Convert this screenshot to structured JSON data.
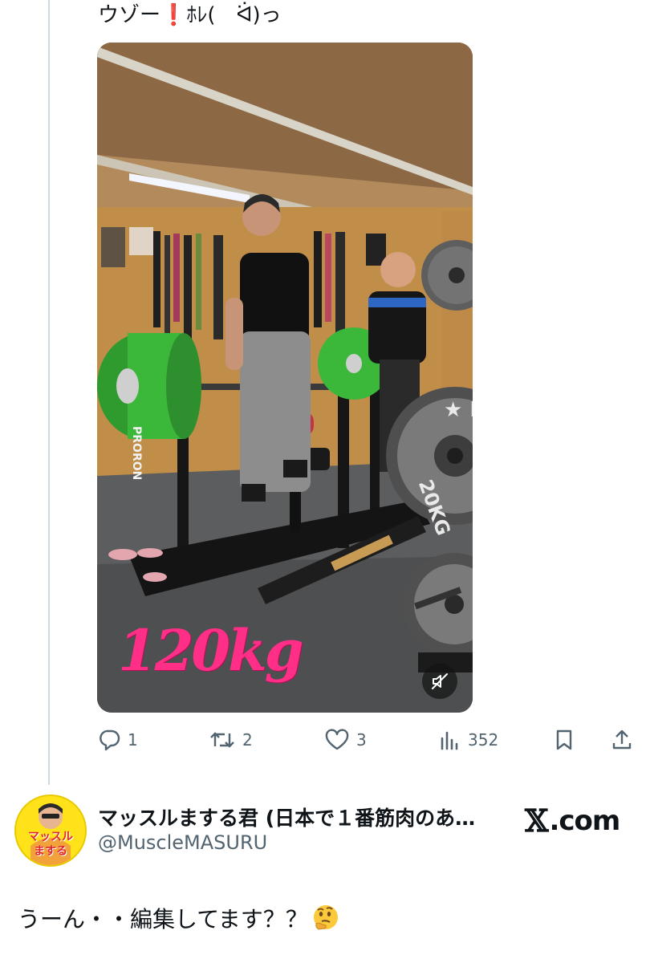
{
  "tweet": {
    "text_main": "ウゾー",
    "text_bang": "❗",
    "text_tail": "ﾎﾚ(　ᐛ)っ"
  },
  "video": {
    "overlay_text": "120kg",
    "muted": true
  },
  "actions": {
    "reply": {
      "icon": "reply-icon",
      "count": "1"
    },
    "repost": {
      "icon": "repost-icon",
      "count": "2"
    },
    "like": {
      "icon": "heart-icon",
      "count": "3"
    },
    "views": {
      "icon": "views-icon",
      "count": "352"
    },
    "bookmark": {
      "icon": "bookmark-icon"
    },
    "share": {
      "icon": "share-icon"
    }
  },
  "quote": {
    "author_name": "マッスルまする君 (日本で１番筋肉のあ…",
    "author_handle": "@MuscleMASURU",
    "source_glyph": "𝕏",
    "source_text": ".com",
    "avatar_text_top": "マッスル",
    "avatar_text_bottom": "まする"
  },
  "reply": {
    "text": "うーん・・編集してます？？",
    "emoji": "thinking-face"
  },
  "colors": {
    "muted_gray": "#536471",
    "thread_line": "#cfd9de",
    "overlay_pink": "#ff2e86",
    "plate_green": "#3bb83a",
    "avatar_yellow": "#ffe21a"
  }
}
